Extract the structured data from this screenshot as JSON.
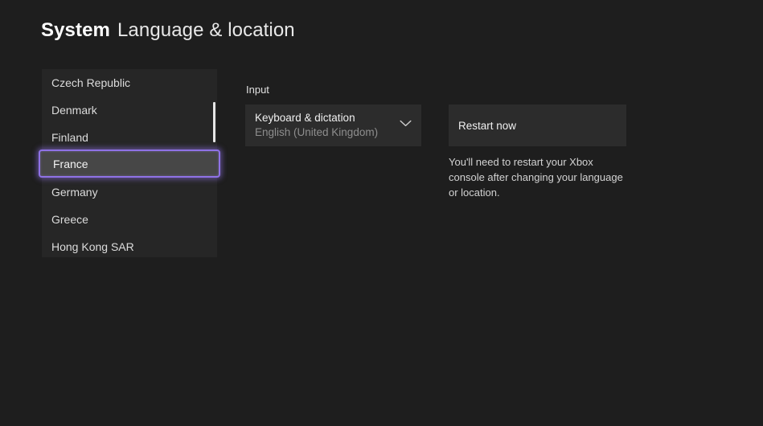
{
  "header": {
    "app_section": "System",
    "page_title": "Language & location"
  },
  "location_list": {
    "items": [
      {
        "label": "Czech Republic",
        "selected": false
      },
      {
        "label": "Denmark",
        "selected": false
      },
      {
        "label": "Finland",
        "selected": false
      },
      {
        "label": "France",
        "selected": true
      },
      {
        "label": "Germany",
        "selected": false
      },
      {
        "label": "Greece",
        "selected": false
      },
      {
        "label": "Hong Kong SAR",
        "selected": false
      }
    ],
    "selected_label": "France",
    "focus_color": "#8f72e6"
  },
  "input_section": {
    "label": "Input",
    "dropdown": {
      "title": "Keyboard & dictation",
      "value": "English (United Kingdom)",
      "icon": "chevron-down-icon"
    }
  },
  "restart_section": {
    "button_label": "Restart now",
    "help_text": "You'll need to restart your Xbox console after changing your language or location."
  }
}
